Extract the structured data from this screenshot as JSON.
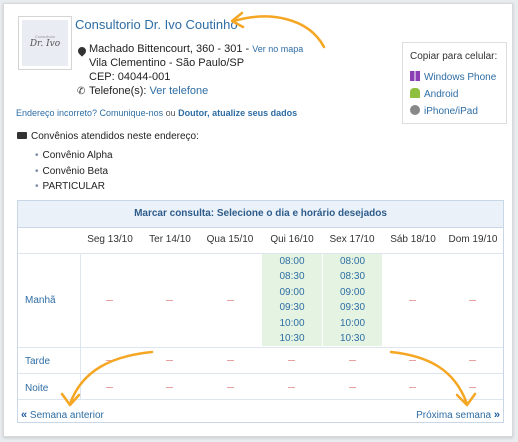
{
  "doctor": {
    "logo_small": "Consultorio",
    "logo_name": "Dr. Ivo",
    "name": "Consultorio Dr. Ivo Coutinho"
  },
  "address": {
    "street": "Machado Bittencourt, 360 - 301 - ",
    "map_link": "Ver no mapa",
    "district": "Vila Clementino - São Paulo/SP",
    "cep": "CEP: 04044-001",
    "phone_label": "Telefone(s): ",
    "phone_link": "Ver telefone"
  },
  "mobile": {
    "title": "Copiar para celular:",
    "items": [
      "Windows Phone",
      "Android",
      "iPhone/iPad"
    ]
  },
  "wrong_address": {
    "text": "Endereço incorreto? Comunique-nos",
    "ou": " ou ",
    "cta": "Doutor, atualize seus dados"
  },
  "convenios": {
    "title": "Convênios atendidos neste endereço:",
    "items": [
      "Convênio Alpha",
      "Convênio Beta",
      "PARTICULAR"
    ]
  },
  "schedule": {
    "title": "Marcar consulta: Selecione o dia e horário desejados",
    "days": [
      "Seg 13/10",
      "Ter 14/10",
      "Qua 15/10",
      "Qui 16/10",
      "Sex 17/10",
      "Sáb 18/10",
      "Dom 19/10"
    ],
    "periods": [
      "Manhã",
      "Tarde",
      "Noite"
    ],
    "thu_slots": [
      "08:00",
      "08:30",
      "09:00",
      "09:30",
      "10:00",
      "10:30"
    ],
    "fri_slots": [
      "08:00",
      "08:30",
      "09:00",
      "09:30",
      "10:00",
      "10:30"
    ],
    "prev": "Semana anterior",
    "next": "Próxima semana"
  },
  "colors": {
    "link": "#2e6da4",
    "arrow": "#f5a623",
    "available": "#e5f4e2",
    "empty_dash": "#e8a0a0"
  }
}
